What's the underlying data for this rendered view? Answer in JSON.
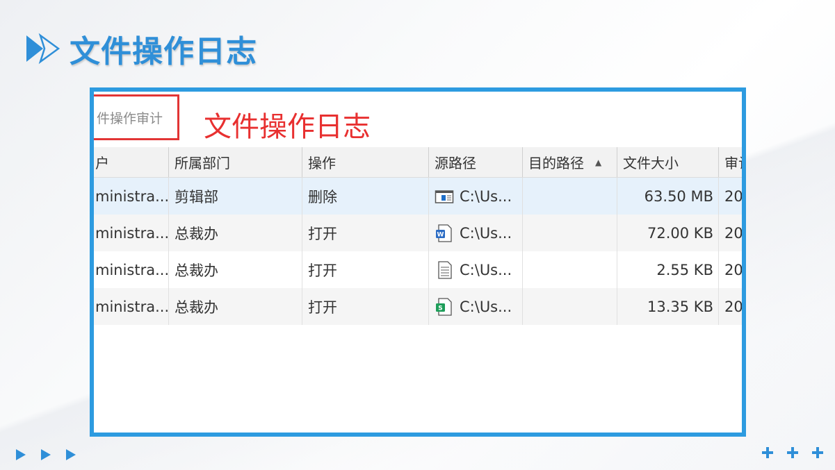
{
  "slide": {
    "title": "文件操作日志",
    "accent_color": "#2f8fd8"
  },
  "screenshot": {
    "tab_label": "件操作审计",
    "annotation": "文件操作日志",
    "columns": {
      "user": "户",
      "dept": "所属部门",
      "op": "操作",
      "src": "源路径",
      "dst": "目的路径",
      "size": "文件大小",
      "audit": "审计"
    },
    "rows": [
      {
        "user": "ministra...",
        "dept": "剪辑部",
        "op": "删除",
        "icon": "window-file-icon",
        "src": "C:\\Us...",
        "dst": "",
        "size": "63.50 MB",
        "audit": "20"
      },
      {
        "user": "ministra...",
        "dept": "总裁办",
        "op": "打开",
        "icon": "word-file-icon",
        "src": "C:\\Us...",
        "dst": "",
        "size": "72.00 KB",
        "audit": "20"
      },
      {
        "user": "ministra...",
        "dept": "总裁办",
        "op": "打开",
        "icon": "text-file-icon",
        "src": "C:\\Us...",
        "dst": "",
        "size": "2.55 KB",
        "audit": "20"
      },
      {
        "user": "ministra...",
        "dept": "总裁办",
        "op": "打开",
        "icon": "spreadsheet-file-icon",
        "src": "C:\\Us...",
        "dst": "",
        "size": "13.35 KB",
        "audit": "20"
      }
    ]
  },
  "colors": {
    "frame_border": "#2d9be0",
    "annotation_red": "#e83030",
    "selected_row": "#e6f1fb"
  }
}
